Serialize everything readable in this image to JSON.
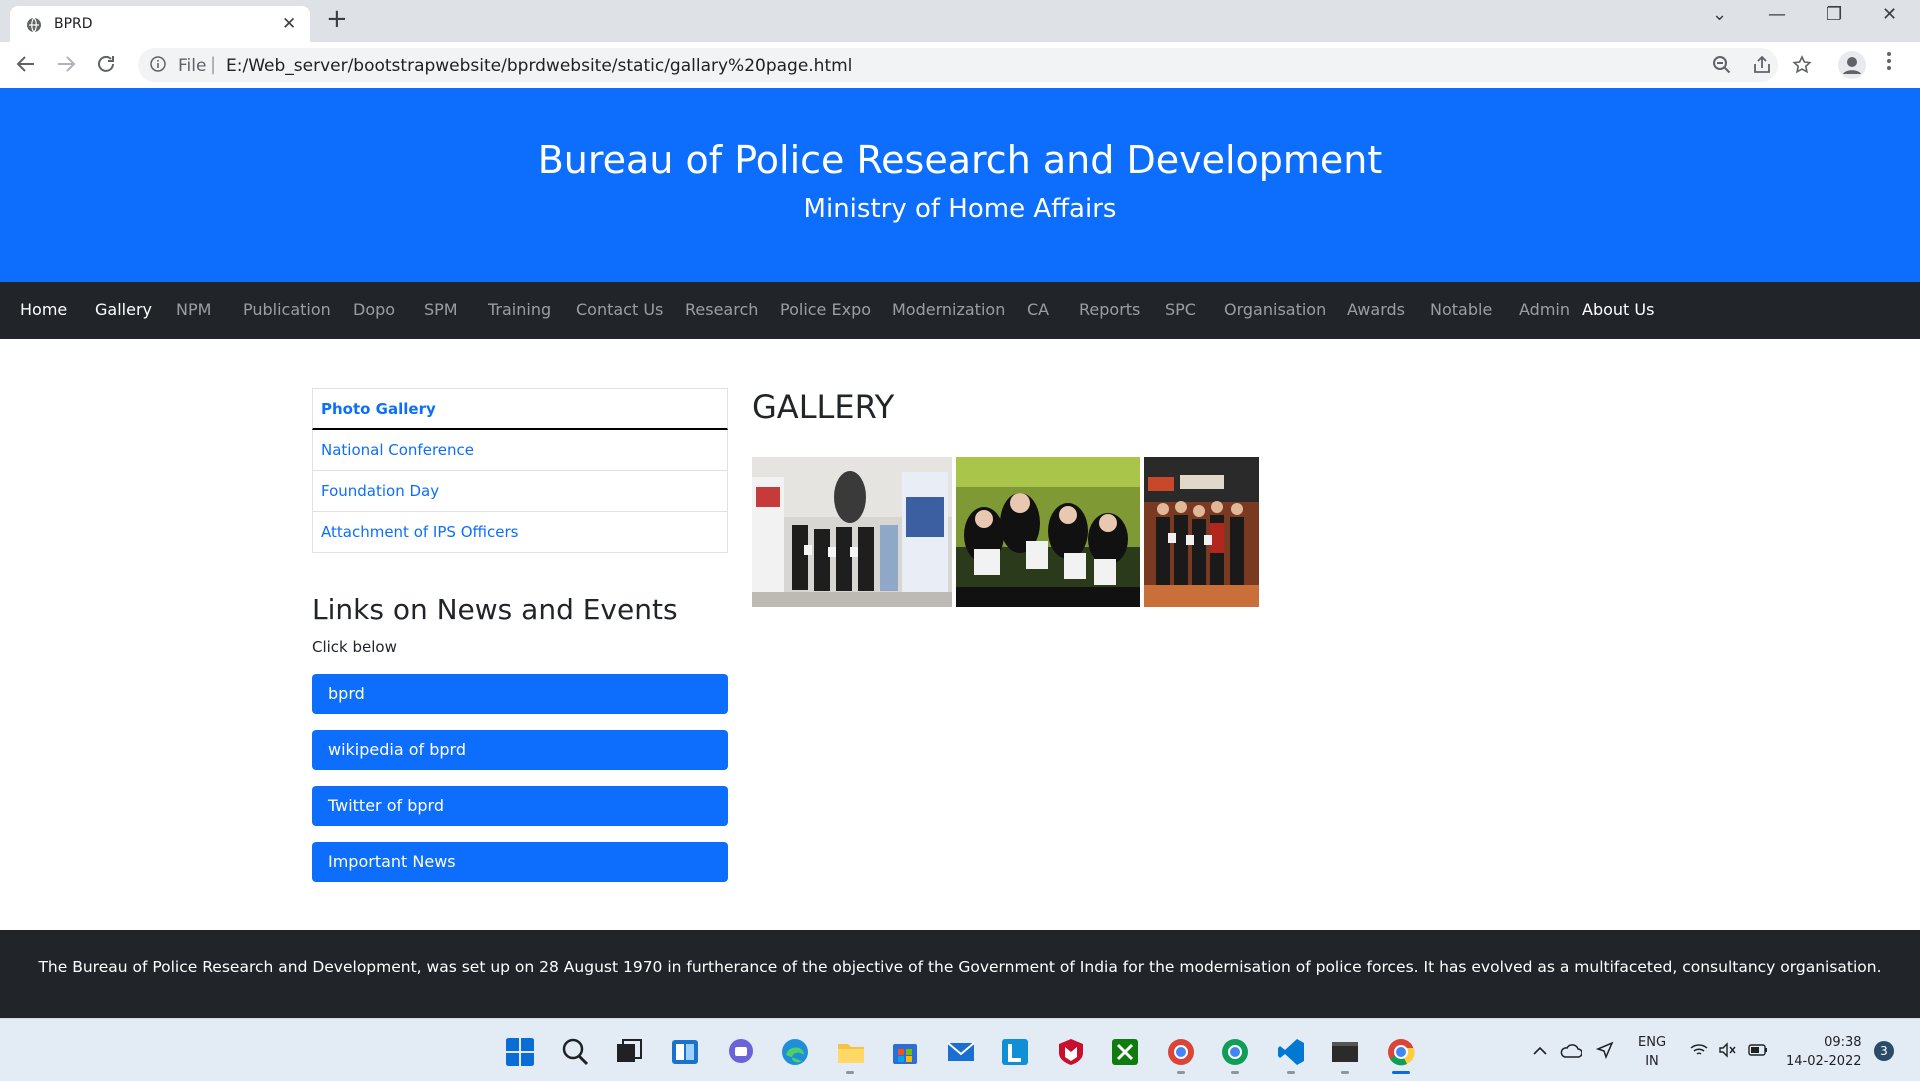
{
  "browser": {
    "tab_title": "BPRD",
    "tab_close": "✕",
    "new_tab": "+",
    "url_scheme": "File",
    "url_separator": "|",
    "url": "E:/Web_server/bootstrapwebsite/bprdwebsite/static/gallary%20page.html",
    "window_controls": [
      "⌄",
      "—",
      "❐",
      "✕"
    ]
  },
  "site": {
    "title": "Bureau of Police Research and Development",
    "subtitle": "Ministry of Home Affairs"
  },
  "nav": [
    {
      "label": "Home",
      "active": true
    },
    {
      "label": "Gallery",
      "active": true
    },
    {
      "label": "NPM",
      "active": false
    },
    {
      "label": "Publication",
      "active": false
    },
    {
      "label": "Dopo",
      "active": false
    },
    {
      "label": "SPM",
      "active": false
    },
    {
      "label": "Training",
      "active": false
    },
    {
      "label": "Contact Us",
      "active": false
    },
    {
      "label": "Research",
      "active": false
    },
    {
      "label": "Police Expo",
      "active": false
    },
    {
      "label": "Modernization",
      "active": false
    },
    {
      "label": "CA",
      "active": false
    },
    {
      "label": "Reports",
      "active": false
    },
    {
      "label": "SPC",
      "active": false
    },
    {
      "label": "Organisation",
      "active": false
    },
    {
      "label": "Awards",
      "active": false
    },
    {
      "label": "Notable",
      "active": false
    },
    {
      "label": "Admin",
      "active": false
    },
    {
      "label": "About Us",
      "active": true
    }
  ],
  "sidebar": {
    "items": [
      {
        "label": "Photo Gallery"
      },
      {
        "label": "National Conference"
      },
      {
        "label": "Foundation Day"
      },
      {
        "label": "Attachment of IPS Officers"
      }
    ]
  },
  "links": {
    "heading": "Links on News and Events",
    "subtext": "Click below",
    "buttons": [
      {
        "label": "bprd"
      },
      {
        "label": "wikipedia of bprd"
      },
      {
        "label": "Twitter of bprd"
      },
      {
        "label": "Important News"
      }
    ]
  },
  "gallery": {
    "heading": "GALLERY",
    "photos": [
      "group-photo-award",
      "venture-championship-photo",
      "utm-library-photo"
    ]
  },
  "footer": {
    "text": "The Bureau of Police Research and Development, was set up on 28 August 1970 in furtherance of the objective of the Government of India for the modernisation of police forces. It has evolved as a multifaceted, consultancy organisation."
  },
  "taskbar": {
    "lang_line1": "ENG",
    "lang_line2": "IN",
    "time": "09:38",
    "date": "14-02-2022",
    "notification_count": "3"
  },
  "colors": {
    "primary": "#0d6efd",
    "dark": "#212529"
  }
}
